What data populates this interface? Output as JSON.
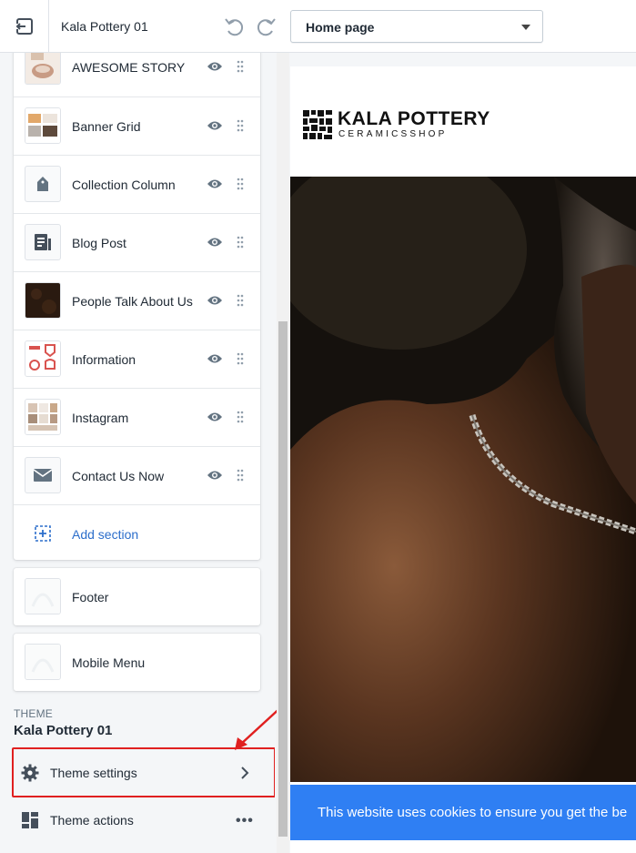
{
  "topbar": {
    "theme_title": "Kala Pottery 01",
    "page_select": "Home page"
  },
  "sections": [
    {
      "label": "AWESOME STORY"
    },
    {
      "label": "Banner Grid"
    },
    {
      "label": "Collection Column"
    },
    {
      "label": "Blog Post"
    },
    {
      "label": "People Talk About Us"
    },
    {
      "label": "Information"
    },
    {
      "label": "Instagram"
    },
    {
      "label": "Contact Us Now"
    }
  ],
  "add_section": "Add section",
  "footer_group": {
    "footer": "Footer",
    "mobile_menu": "Mobile Menu"
  },
  "theme": {
    "caption": "THEME",
    "name": "Kala Pottery 01",
    "settings": "Theme settings",
    "actions": "Theme actions",
    "more": "•••"
  },
  "preview": {
    "logo_name": "KALA POTTERY",
    "logo_sub": "CERAMICSSHOP",
    "cookie_text": "This website uses cookies to ensure you get the be"
  },
  "colors": {
    "accent": "#2c6ecb",
    "highlight": "#e02020",
    "cookie_bar": "#2f7ff3"
  }
}
